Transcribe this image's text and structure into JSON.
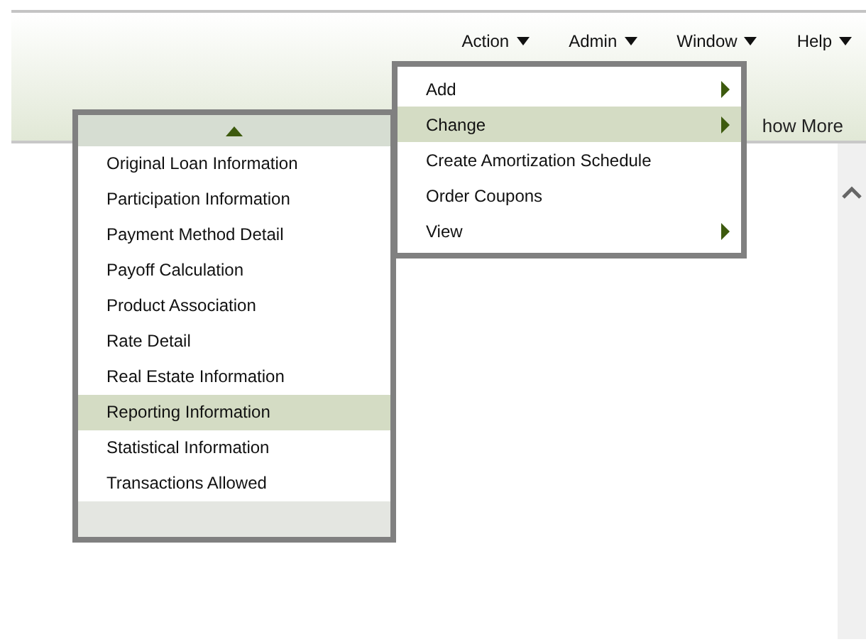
{
  "menubar": [
    {
      "label": "Action"
    },
    {
      "label": "Admin"
    },
    {
      "label": "Window"
    },
    {
      "label": "Help"
    }
  ],
  "header_link": "how More",
  "action_menu": [
    {
      "label": "Add",
      "selected": false,
      "has_submenu": true
    },
    {
      "label": "Change",
      "selected": true,
      "has_submenu": true
    },
    {
      "label": "Create Amortization Schedule",
      "selected": false,
      "has_submenu": false
    },
    {
      "label": "Order Coupons",
      "selected": false,
      "has_submenu": false
    },
    {
      "label": "View",
      "selected": false,
      "has_submenu": true
    }
  ],
  "change_submenu": [
    {
      "label": "Original Loan Information",
      "selected": false
    },
    {
      "label": "Participation Information",
      "selected": false
    },
    {
      "label": "Payment Method Detail",
      "selected": false
    },
    {
      "label": "Payoff Calculation",
      "selected": false
    },
    {
      "label": "Product Association",
      "selected": false
    },
    {
      "label": "Rate Detail",
      "selected": false
    },
    {
      "label": "Real Estate Information",
      "selected": false
    },
    {
      "label": "Reporting Information",
      "selected": true
    },
    {
      "label": "Statistical Information",
      "selected": false
    },
    {
      "label": "Transactions Allowed",
      "selected": false
    }
  ]
}
